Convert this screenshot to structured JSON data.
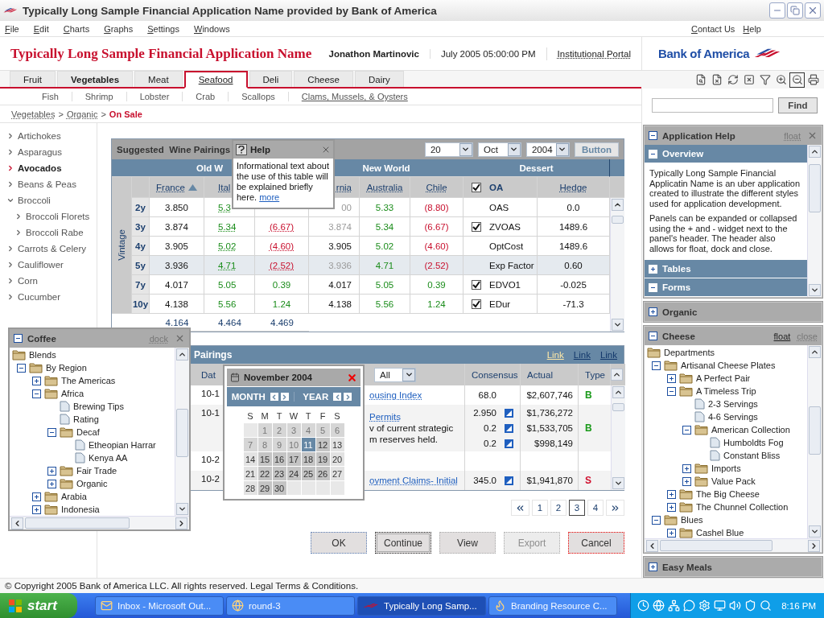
{
  "window": {
    "title": "Typically Long Sample Financial Application Name provided by Bank of America"
  },
  "menu": [
    "File",
    "Edit",
    "Charts",
    "Graphs",
    "Settings",
    "Windows"
  ],
  "utility_links": [
    "Contact Us",
    "Help"
  ],
  "header": {
    "app_name": "Typically Long Sample Financial Application Name",
    "user": "Jonathon Martinovic",
    "datetime": "July 2005  05:00:00 PM",
    "portal_link": "Institutional Portal",
    "logo_text": "Bank of America"
  },
  "tabs": [
    {
      "label": "Fruit",
      "selected": false,
      "emphasized": false
    },
    {
      "label": "Vegetables",
      "selected": false,
      "emphasized": true
    },
    {
      "label": "Meat",
      "selected": false,
      "emphasized": false
    },
    {
      "label": "Seafood",
      "selected": true,
      "emphasized": false
    },
    {
      "label": "Deli",
      "selected": false,
      "emphasized": false
    },
    {
      "label": "Cheese",
      "selected": false,
      "emphasized": false
    },
    {
      "label": "Dairy",
      "selected": false,
      "emphasized": false
    }
  ],
  "toolbar": [
    {
      "kind": "find",
      "selected": false
    },
    {
      "kind": "clear",
      "selected": false
    },
    {
      "kind": "refresh",
      "selected": false
    },
    {
      "kind": "delete",
      "selected": false
    },
    {
      "kind": "filter",
      "selected": false
    },
    {
      "kind": "zoom-in",
      "selected": false
    },
    {
      "kind": "zoom-out",
      "selected": true
    },
    {
      "kind": "print",
      "selected": false
    }
  ],
  "subtabs": [
    {
      "label": "Fish",
      "hovered": false
    },
    {
      "label": "Shrimp",
      "hovered": false
    },
    {
      "label": "Lobster",
      "hovered": false
    },
    {
      "label": "Crab",
      "hovered": false
    },
    {
      "label": "Scallops",
      "hovered": false
    },
    {
      "label": "Clams, Mussels, & Oysters",
      "hovered": true
    }
  ],
  "breadcrumb": {
    "separator": ">",
    "items": [
      {
        "label": "Vegetables",
        "kind": "link"
      },
      {
        "label": "Organic",
        "kind": "link"
      },
      {
        "label": "On Sale",
        "kind": "current"
      }
    ]
  },
  "nav": [
    {
      "label": "Artichokes",
      "selected": false,
      "expanded": false
    },
    {
      "label": "Asparagus",
      "selected": false,
      "expanded": false
    },
    {
      "label": "Avocados",
      "selected": true,
      "expanded": false
    },
    {
      "label": "Beans & Peas",
      "selected": false,
      "expanded": false
    },
    {
      "label": "Broccoli",
      "selected": false,
      "expanded": true,
      "children": [
        {
          "label": "Broccoli Florets",
          "selected": false,
          "expanded": false
        },
        {
          "label": "Broccoli Rabe",
          "selected": false,
          "expanded": false
        }
      ]
    },
    {
      "label": "Carrots & Celery",
      "selected": false,
      "expanded": false
    },
    {
      "label": "Cauliflower",
      "selected": false,
      "expanded": false
    },
    {
      "label": "Corn",
      "selected": false,
      "expanded": false
    },
    {
      "label": "Cucumber",
      "selected": false,
      "expanded": false
    }
  ],
  "wine_table": {
    "title": "Suggested  Wine Pairings",
    "day": "20",
    "month": "Oct",
    "year": "2004",
    "button": "Button",
    "groups": [
      "Old W",
      "New World",
      "Dessert"
    ],
    "row_header": "Vintage",
    "columns": [
      {
        "label": "France",
        "sorted": true
      },
      {
        "label": "Ital"
      },
      {},
      {
        "label": "rnia",
        "sorted": false
      },
      {
        "label": "Australia",
        "sorted": false
      },
      {
        "label": "Chile",
        "sorted": false
      }
    ],
    "check_header": {
      "label": "OA",
      "checked": true
    },
    "hedge_header": "Hedge",
    "rows": [
      {
        "term": "2y",
        "highlighted": false,
        "checked": false,
        "name": "OAS",
        "hedge": "0.0",
        "values": [
          {
            "text": "3.850",
            "kind": "plain",
            "link": false
          },
          {
            "text": "5.3",
            "kind": "positive",
            "link": true
          },
          {
            "kind": "hidden"
          },
          {
            "text": "00",
            "kind": "faded",
            "link": false
          },
          {
            "text": "5.33",
            "kind": "positive",
            "link": false
          },
          {
            "text": "(8.80)",
            "kind": "negative",
            "link": false
          }
        ]
      },
      {
        "term": "3y",
        "highlighted": false,
        "checked": true,
        "name": "ZVOAS",
        "hedge": "1489.6",
        "values": [
          {
            "text": "3.874",
            "kind": "plain",
            "link": false
          },
          {
            "text": "5.34",
            "kind": "positive",
            "link": true
          },
          {
            "text": "(6.67)",
            "kind": "negative",
            "link": true
          },
          {
            "text": "3.874",
            "kind": "faded",
            "link": false
          },
          {
            "text": "5.34",
            "kind": "positive",
            "link": false
          },
          {
            "text": "(6.67)",
            "kind": "negative",
            "link": false
          }
        ]
      },
      {
        "term": "4y",
        "highlighted": false,
        "checked": false,
        "name": "OptCost",
        "hedge": "1489.6",
        "values": [
          {
            "text": "3.905",
            "kind": "plain",
            "link": false
          },
          {
            "text": "5.02",
            "kind": "positive",
            "link": true
          },
          {
            "text": "(4.60)",
            "kind": "negative",
            "link": true
          },
          {
            "text": "3.905",
            "kind": "plain",
            "link": false
          },
          {
            "text": "5.02",
            "kind": "positive",
            "link": false
          },
          {
            "text": "(4.60)",
            "kind": "negative",
            "link": false
          }
        ]
      },
      {
        "term": "5y",
        "highlighted": true,
        "checked": false,
        "name": "Exp Factor",
        "hedge": "0.60",
        "values": [
          {
            "text": "3.936",
            "kind": "plain",
            "link": false
          },
          {
            "text": "4.71",
            "kind": "positive",
            "link": true
          },
          {
            "text": "(2.52)",
            "kind": "negative",
            "link": true
          },
          {
            "text": "3.936",
            "kind": "faded",
            "link": false
          },
          {
            "text": "4.71",
            "kind": "positive",
            "link": false
          },
          {
            "text": "(2.52)",
            "kind": "negative",
            "link": false
          }
        ]
      },
      {
        "term": "7y",
        "highlighted": false,
        "checked": true,
        "name": "EDVO1",
        "hedge": "-0.025",
        "values": [
          {
            "text": "4.017",
            "kind": "plain",
            "link": false
          },
          {
            "text": "5.05",
            "kind": "positive",
            "link": false
          },
          {
            "text": "0.39",
            "kind": "positive",
            "link": false
          },
          {
            "text": "4.017",
            "kind": "plain",
            "link": false
          },
          {
            "text": "5.05",
            "kind": "positive",
            "link": false
          },
          {
            "text": "0.39",
            "kind": "positive",
            "link": false
          }
        ]
      },
      {
        "term": "10y",
        "highlighted": false,
        "checked": true,
        "name": "EDur",
        "hedge": "-71.3",
        "values": [
          {
            "text": "4.138",
            "kind": "plain",
            "link": false
          },
          {
            "text": "5.56",
            "kind": "positive",
            "link": false
          },
          {
            "text": "1.24",
            "kind": "positive",
            "link": false
          },
          {
            "text": "4.138",
            "kind": "plain",
            "link": false
          },
          {
            "text": "5.56",
            "kind": "positive",
            "link": false
          },
          {
            "text": "1.24",
            "kind": "positive",
            "link": false
          }
        ]
      }
    ],
    "totals": [
      "4.164",
      "4.464",
      "4.469"
    ]
  },
  "pairings_table": {
    "title": "Pairings",
    "links": [
      {
        "label": "Link",
        "highlighted": true
      },
      {
        "label": "Link",
        "highlighted": false
      },
      {
        "label": "Link",
        "highlighted": false
      }
    ],
    "date_header": "Dat",
    "filter": "All",
    "headers": [
      "Consensus",
      "Actual",
      "Type"
    ],
    "rows": [
      {
        "date": "10-1",
        "link": "ousing Index",
        "consensus": [
          {
            "value": "68.0",
            "editable": false
          }
        ],
        "actual": [
          "$2,607,746"
        ],
        "type": {
          "label": "B",
          "kind": "buy"
        }
      },
      {
        "date": "10-1",
        "link": "Permits",
        "notes": [
          "v of current strategic",
          "m reserves held."
        ],
        "consensus": [
          {
            "value": "2.950",
            "editable": true
          },
          {
            "value": "0.2",
            "editable": true
          },
          {
            "value": "0.2",
            "editable": true
          }
        ],
        "actual": [
          "$1,736,272",
          "$1,533,705",
          "$998,149"
        ],
        "type": {
          "label": "B",
          "kind": "buy"
        }
      },
      {
        "date": "10-2"
      },
      {
        "date": "10-2",
        "link": "oyment Claims- Initial",
        "consensus": [
          {
            "value": "345.0",
            "editable": true
          }
        ],
        "actual": [
          "$1,941,870"
        ],
        "type": {
          "label": "S",
          "kind": "sell"
        }
      }
    ]
  },
  "pagination": {
    "pages": [
      {
        "label": "1",
        "selected": false
      },
      {
        "label": "2",
        "selected": false
      },
      {
        "label": "3",
        "selected": true
      },
      {
        "label": "4",
        "selected": false
      }
    ]
  },
  "buttons": [
    {
      "label": "OK",
      "kind": "primary",
      "disabled": false
    },
    {
      "label": "Continue",
      "kind": "focused",
      "disabled": false
    },
    {
      "label": "View",
      "kind": "normal",
      "disabled": false
    },
    {
      "label": "Export",
      "kind": "normal",
      "disabled": true
    },
    {
      "label": "Cancel",
      "kind": "cancel",
      "disabled": false
    }
  ],
  "search": {
    "button": "Find"
  },
  "panels": [
    {
      "title": "Application Help",
      "kind": "help",
      "expanded": true,
      "closable": true,
      "actions": [
        {
          "label": "float",
          "hovered": false
        }
      ],
      "sections": [
        {
          "title": "Overview",
          "expanded": true,
          "paragraphs": [
            "Typically Long Sample Financial Applicatin Name is an uber application created to illustrate the different styles used for application development.",
            "Panels can be expanded or collapsed using the + and - widget next to the panel's header. The header also allows for float, dock and close."
          ]
        },
        {
          "title": "Tables",
          "expanded": false
        },
        {
          "title": "Forms",
          "expanded": true
        }
      ]
    },
    {
      "title": "Organic",
      "kind": "plain",
      "expanded": false,
      "closable": false
    },
    {
      "title": "Cheese",
      "kind": "tree",
      "expanded": true,
      "closable": false,
      "actions": [
        {
          "label": "float",
          "hovered": true
        },
        {
          "label": "close",
          "hovered": false
        }
      ],
      "tree": [
        {
          "label": "Departments",
          "kind": "folder",
          "expanded": true,
          "children": [
            {
              "label": "Artisanal Cheese Plates",
              "kind": "folder",
              "expanded": true,
              "children": [
                {
                  "label": "A Perfect Pair",
                  "kind": "folder",
                  "expanded": false
                },
                {
                  "label": "A Timeless Trip",
                  "kind": "folder",
                  "expanded": true,
                  "children": [
                    {
                      "label": "2-3 Servings",
                      "kind": "leaf"
                    },
                    {
                      "label": "4-6 Servings",
                      "kind": "leaf"
                    },
                    {
                      "label": "American Collection",
                      "kind": "folder",
                      "expanded": true,
                      "children": [
                        {
                          "label": "Humboldts Fog",
                          "kind": "leaf"
                        },
                        {
                          "label": "Constant Bliss",
                          "kind": "leaf"
                        }
                      ]
                    },
                    {
                      "label": "Imports",
                      "kind": "folder",
                      "expanded": false
                    },
                    {
                      "label": "Value Pack",
                      "kind": "folder",
                      "expanded": false
                    }
                  ]
                },
                {
                  "label": "The Big Cheese",
                  "kind": "folder",
                  "expanded": false
                },
                {
                  "label": "The Chunnel Collection",
                  "kind": "folder",
                  "expanded": false
                }
              ]
            },
            {
              "label": "Blues",
              "kind": "folder",
              "expanded": true,
              "children": [
                {
                  "label": "Cashel Blue",
                  "kind": "folder",
                  "expanded": false
                }
              ]
            }
          ]
        }
      ]
    },
    {
      "title": "Easy Meals",
      "kind": "plain",
      "expanded": false,
      "closable": false
    }
  ],
  "floating_panel": {
    "title": "Coffee",
    "expanded": true,
    "closable": true,
    "actions": [
      {
        "label": "dock",
        "hovered": false
      }
    ],
    "tree": [
      {
        "label": "Blends",
        "kind": "folder",
        "expanded": true,
        "children": [
          {
            "label": "By Region",
            "kind": "folder",
            "expanded": true,
            "children": [
              {
                "label": "The Americas",
                "kind": "folder",
                "expanded": false
              },
              {
                "label": "Africa",
                "kind": "folder",
                "expanded": true,
                "children": [
                  {
                    "label": "Brewing Tips",
                    "kind": "leaf"
                  },
                  {
                    "label": "Rating",
                    "kind": "leaf"
                  },
                  {
                    "label": "Decaf",
                    "kind": "folder",
                    "expanded": true,
                    "children": [
                      {
                        "label": "Etheopian Harrar",
                        "kind": "leaf"
                      },
                      {
                        "label": "Kenya AA",
                        "kind": "leaf"
                      }
                    ]
                  },
                  {
                    "label": "Fair Trade",
                    "kind": "folder",
                    "expanded": false
                  },
                  {
                    "label": "Organic",
                    "kind": "folder",
                    "expanded": false
                  }
                ]
              },
              {
                "label": "Arabia",
                "kind": "folder",
                "expanded": false
              },
              {
                "label": "Indonesia",
                "kind": "folder",
                "expanded": false
              }
            ]
          }
        ]
      }
    ]
  },
  "help_popup": {
    "title": "Help",
    "text": "Informational text about the use of this table will be explained briefly here.",
    "link": "more"
  },
  "calendar": {
    "title": "November 2004",
    "month_label": "MONTH",
    "year_label": "YEAR",
    "weekdays": [
      "S",
      "M",
      "T",
      "W",
      "T",
      "F",
      "S"
    ],
    "days": [
      {
        "kind": "blank"
      },
      {
        "kind": "day",
        "label": "1",
        "disabled": true,
        "selected": false
      },
      {
        "kind": "day",
        "label": "2",
        "disabled": true,
        "selected": false
      },
      {
        "kind": "day",
        "label": "3",
        "disabled": true,
        "selected": false
      },
      {
        "kind": "day",
        "label": "4",
        "disabled": true,
        "selected": false
      },
      {
        "kind": "day",
        "label": "5",
        "disabled": true,
        "selected": false
      },
      {
        "kind": "day",
        "label": "6",
        "disabled": true,
        "selected": false
      },
      {
        "kind": "day",
        "label": "7",
        "disabled": true,
        "selected": false
      },
      {
        "kind": "day",
        "label": "8",
        "disabled": true,
        "selected": false
      },
      {
        "kind": "day",
        "label": "9",
        "disabled": true,
        "selected": false
      },
      {
        "kind": "day",
        "label": "10",
        "disabled": true,
        "selected": false
      },
      {
        "kind": "day",
        "label": "11",
        "disabled": false,
        "selected": true
      },
      {
        "kind": "day",
        "label": "12",
        "disabled": false,
        "selected": false
      },
      {
        "kind": "day",
        "label": "13",
        "disabled": false,
        "selected": false
      },
      {
        "kind": "day",
        "label": "14",
        "disabled": false,
        "selected": false
      },
      {
        "kind": "day",
        "label": "15",
        "disabled": false,
        "selected": false
      },
      {
        "kind": "day",
        "label": "16",
        "disabled": false,
        "selected": false
      },
      {
        "kind": "day",
        "label": "17",
        "disabled": false,
        "selected": false
      },
      {
        "kind": "day",
        "label": "18",
        "disabled": false,
        "selected": false
      },
      {
        "kind": "day",
        "label": "19",
        "disabled": false,
        "selected": false
      },
      {
        "kind": "day",
        "label": "20",
        "disabled": false,
        "selected": false
      },
      {
        "kind": "day",
        "label": "21",
        "disabled": false,
        "selected": false
      },
      {
        "kind": "day",
        "label": "22",
        "disabled": false,
        "selected": false
      },
      {
        "kind": "day",
        "label": "23",
        "disabled": false,
        "selected": false
      },
      {
        "kind": "day",
        "label": "24",
        "disabled": false,
        "selected": false
      },
      {
        "kind": "day",
        "label": "25",
        "disabled": false,
        "selected": false
      },
      {
        "kind": "day",
        "label": "26",
        "disabled": false,
        "selected": false
      },
      {
        "kind": "day",
        "label": "27",
        "disabled": false,
        "selected": false
      },
      {
        "kind": "day",
        "label": "28",
        "disabled": false,
        "selected": false
      },
      {
        "kind": "day",
        "label": "29",
        "disabled": false,
        "selected": false
      },
      {
        "kind": "day",
        "label": "30",
        "disabled": false,
        "selected": false
      },
      {
        "kind": "blank"
      },
      {
        "kind": "blank"
      },
      {
        "kind": "blank"
      },
      {
        "kind": "blank"
      }
    ]
  },
  "footer": {
    "copyright": "© Copyright 2005 Bank of America LLC. All rights reserved. Legal Terms & Conditions."
  },
  "taskbar": {
    "start": "start",
    "tasks": [
      {
        "label": "Inbox - Microsoft Out...",
        "kind": "mail",
        "selected": false
      },
      {
        "label": "round-3",
        "kind": "browser",
        "selected": false
      },
      {
        "label": "Typically Long  Samp...",
        "kind": "app",
        "selected": true
      },
      {
        "label": "Branding Resource C...",
        "kind": "firefox",
        "selected": false
      }
    ],
    "clock": "8:16 PM"
  }
}
